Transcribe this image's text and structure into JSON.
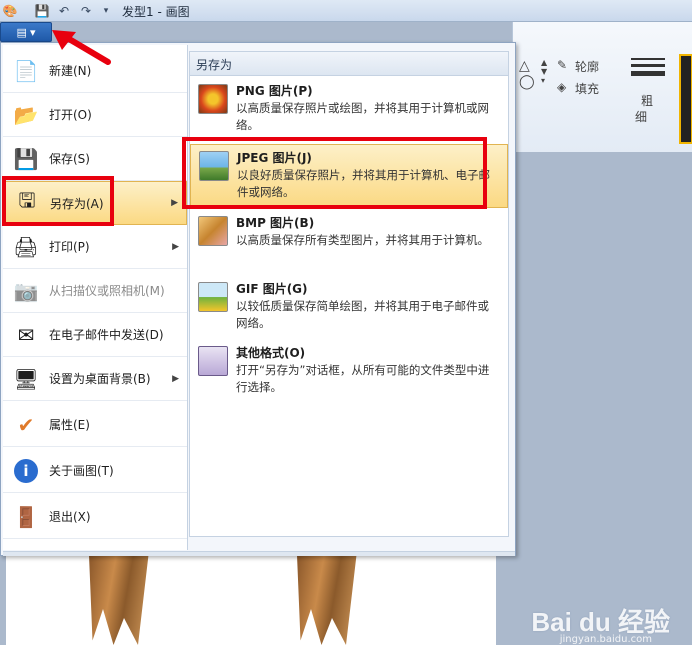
{
  "window": {
    "title": "发型1 - 画图"
  },
  "quick_access": [
    "paint-app-icon",
    "save-icon",
    "undo-icon",
    "redo-icon",
    "customize-dropdown-icon"
  ],
  "ribbon": {
    "outline": "轮廓",
    "fill": "填充",
    "size_line1": "粗",
    "size_line2": "细"
  },
  "file_menu": {
    "items": [
      {
        "label": "新建(N)",
        "icon": "new-file-icon",
        "has_submenu": false,
        "disabled": false
      },
      {
        "label": "打开(O)",
        "icon": "open-folder-icon",
        "has_submenu": false,
        "disabled": false
      },
      {
        "label": "保存(S)",
        "icon": "save-icon",
        "has_submenu": false,
        "disabled": false
      },
      {
        "label": "另存为(A)",
        "icon": "save-as-icon",
        "has_submenu": true,
        "disabled": false
      },
      {
        "label": "打印(P)",
        "icon": "printer-icon",
        "has_submenu": true,
        "disabled": false
      },
      {
        "label": "从扫描仪或照相机(M)",
        "icon": "scanner-icon",
        "has_submenu": false,
        "disabled": true
      },
      {
        "label": "在电子邮件中发送(D)",
        "icon": "email-icon",
        "has_submenu": false,
        "disabled": false
      },
      {
        "label": "设置为桌面背景(B)",
        "icon": "desktop-background-icon",
        "has_submenu": true,
        "disabled": false
      },
      {
        "label": "属性(E)",
        "icon": "checkmark-icon",
        "has_submenu": false,
        "disabled": false
      },
      {
        "label": "关于画图(T)",
        "icon": "info-icon",
        "has_submenu": false,
        "disabled": false
      },
      {
        "label": "退出(X)",
        "icon": "exit-icon",
        "has_submenu": false,
        "disabled": false
      }
    ]
  },
  "save_as_submenu": {
    "header": "另存为",
    "items": [
      {
        "title": "PNG 图片(P)",
        "desc": "以高质量保存照片或绘图，并将其用于计算机或网络。",
        "icon": "png-image-icon"
      },
      {
        "title": "JPEG 图片(J)",
        "desc": "以良好质量保存照片，并将其用于计算机、电子邮件或网络。",
        "icon": "jpeg-image-icon"
      },
      {
        "title": "BMP 图片(B)",
        "desc": "以高质量保存所有类型图片，并将其用于计算机。",
        "icon": "bmp-image-icon"
      },
      {
        "title": "GIF 图片(G)",
        "desc": "以较低质量保存简单绘图，并将其用于电子邮件或网络。",
        "icon": "gif-image-icon"
      },
      {
        "title": "其他格式(O)",
        "desc": "打开“另存为”对话框，从所有可能的文件类型中进行选择。",
        "icon": "other-formats-icon"
      }
    ]
  },
  "watermark": {
    "logo": "Bai du 经验",
    "url": "jingyan.baidu.com"
  },
  "colors": {
    "highlight_red": "#e8000e",
    "selection_gold": "#fbd983",
    "menu_blue": "#1f59a8"
  }
}
